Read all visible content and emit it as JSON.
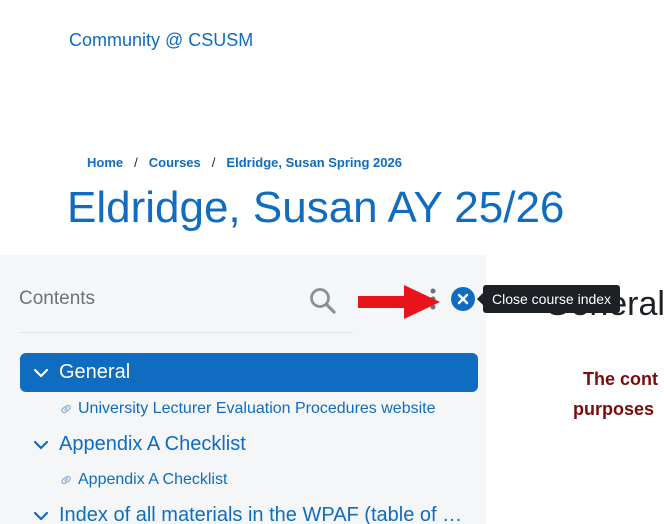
{
  "site": {
    "name": "Community @ CSUSM"
  },
  "breadcrumb": {
    "items": [
      "Home",
      "Courses",
      "Eldridge, Susan Spring 2026"
    ],
    "separator": "/"
  },
  "page": {
    "title": "Eldridge, Susan AY 25/26"
  },
  "course_index": {
    "title": "Contents",
    "search_icon": "search-icon",
    "close_tooltip": "Close course index",
    "sections": [
      {
        "label": "General",
        "expanded": true,
        "active": true,
        "activities": [
          {
            "label": "University Lecturer Evaluation Procedures website",
            "icon": "link-icon"
          }
        ]
      },
      {
        "label": "Appendix A Checklist",
        "expanded": true,
        "active": false,
        "activities": [
          {
            "label": "Appendix A Checklist",
            "icon": "link-icon"
          }
        ]
      },
      {
        "label": "Index of all materials in the WPAF (table of c...",
        "expanded": true,
        "active": false,
        "activities": []
      }
    ]
  },
  "main": {
    "section_heading": "General",
    "text_line1": "The cont",
    "text_line2": "purposes"
  },
  "colors": {
    "accent": "#0f6cbf",
    "drawer_bg": "#f5f6f8",
    "tooltip_bg": "#1d2125",
    "annotation_arrow": "#e8141b",
    "notice_text": "#7a0c0c"
  }
}
